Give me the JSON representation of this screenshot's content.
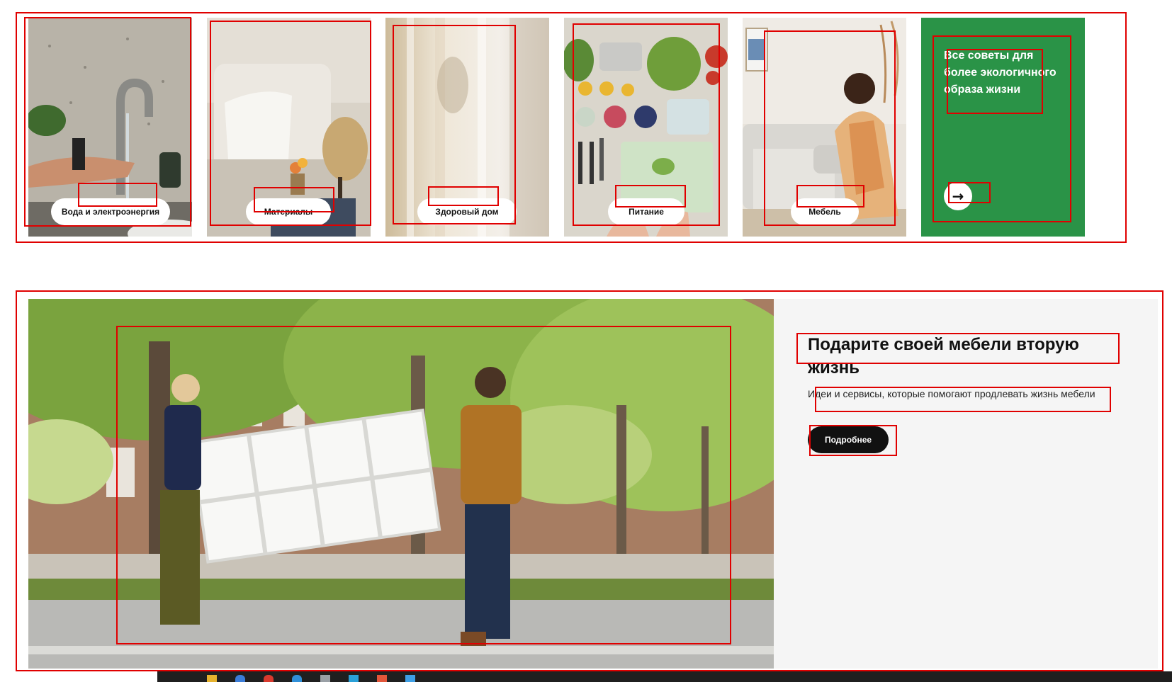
{
  "eco_tiles": {
    "items": [
      {
        "label": "Вода и электроэнергия"
      },
      {
        "label": "Материалы"
      },
      {
        "label": "Здоровый дом"
      },
      {
        "label": "Питание"
      },
      {
        "label": "Мебель"
      }
    ],
    "all_tips": {
      "text": "Все советы для более экологичного образа жизни",
      "arrow": "→"
    }
  },
  "banner": {
    "title": "Подарите своей мебели вторую жизнь",
    "subtitle": "Идеи и сервисы, которые помогают продлевать жизнь мебели",
    "button_label": "Подробнее"
  },
  "colors": {
    "accent_green": "#2a9347",
    "annotation_red": "#e00000",
    "banner_bg": "#f5f5f5",
    "button_dark": "#111111"
  }
}
